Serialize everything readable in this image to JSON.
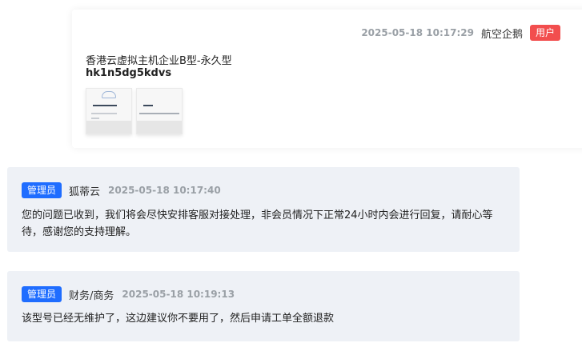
{
  "user_message": {
    "timestamp": "2025-05-18 10:17:29",
    "author": "航空企鹅",
    "role_badge": "用户",
    "product_line": "香港云虚拟主机企业B型-永久型",
    "account_line": "hk1n5dg5kdvs",
    "attachments": [
      {
        "name": "attachment-1"
      },
      {
        "name": "attachment-2"
      }
    ]
  },
  "replies": [
    {
      "role_badge": "管理员",
      "author": "狐蒂云",
      "timestamp": "2025-05-18 10:17:40",
      "text": "您的问题已收到，我们将会尽快安排客服对接处理，非会员情况下正常24小时内会进行回复，请耐心等待，感谢您的支持理解。"
    },
    {
      "role_badge": "管理员",
      "author": "财务/商务",
      "timestamp": "2025-05-18 10:19:13",
      "text": "该型号已经无维护了，这边建议你不要用了，然后申请工单全额退款"
    }
  ],
  "colors": {
    "user_badge": "#f24e4e",
    "admin_badge": "#1f6dff",
    "admin_bg": "#eef1f6"
  }
}
